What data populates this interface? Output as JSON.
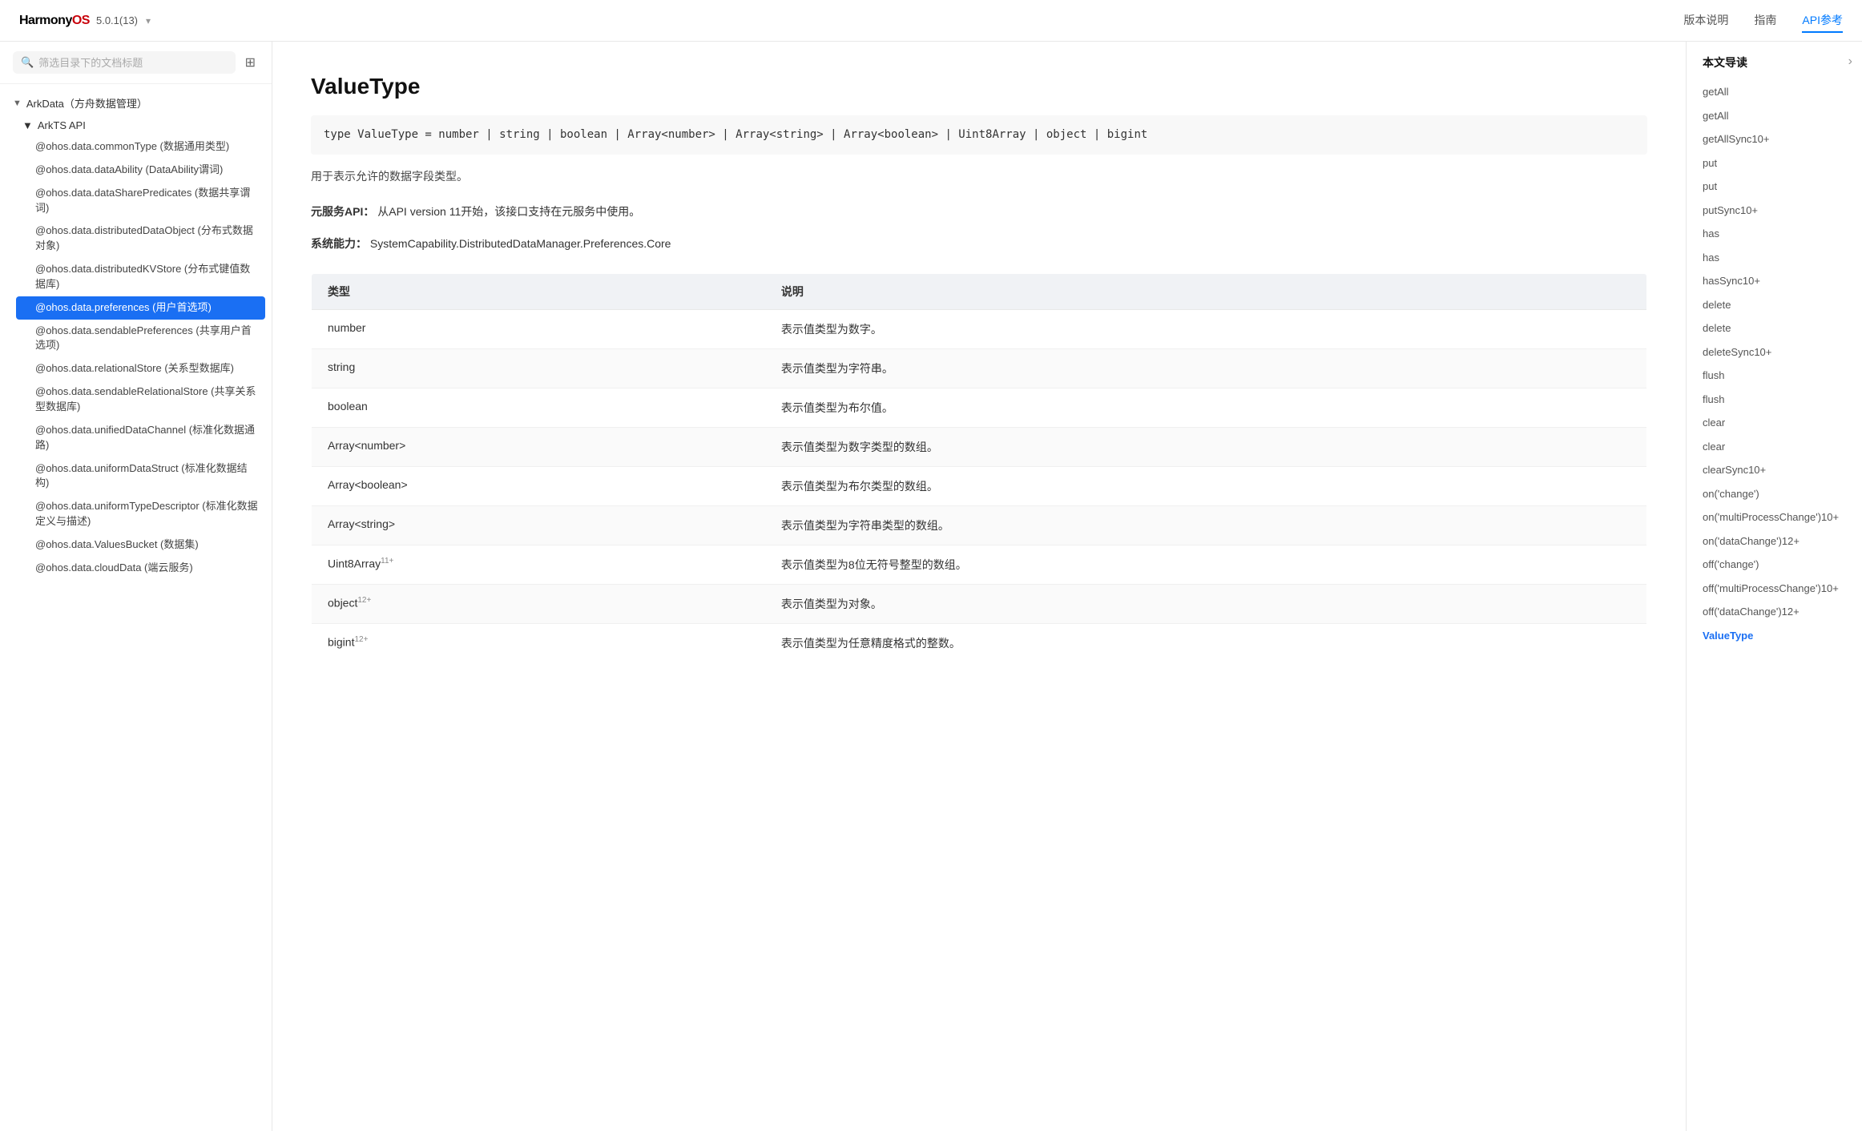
{
  "brand": {
    "name_part1": "Harmony",
    "name_part2": "OS",
    "version": "5.0.1(13)",
    "dropdown_icon": "▾"
  },
  "nav": {
    "links": [
      {
        "label": "版本说明",
        "active": false
      },
      {
        "label": "指南",
        "active": false
      },
      {
        "label": "API参考",
        "active": true
      }
    ]
  },
  "sidebar": {
    "search_placeholder": "筛选目录下的文档标题",
    "tree": {
      "section_label": "ArkData（方舟数据管理）",
      "sub_section_label": "ArkTS API",
      "items": [
        {
          "label": "@ohos.data.commonType (数据通用类型)",
          "active": false
        },
        {
          "label": "@ohos.data.dataAbility (DataAbility谓词)",
          "active": false
        },
        {
          "label": "@ohos.data.dataSharePredicates (数据共享谓词)",
          "active": false
        },
        {
          "label": "@ohos.data.distributedDataObject (分布式数据对象)",
          "active": false
        },
        {
          "label": "@ohos.data.distributedKVStore (分布式键值数据库)",
          "active": false
        },
        {
          "label": "@ohos.data.preferences (用户首选项)",
          "active": true
        },
        {
          "label": "@ohos.data.sendablePreferences (共享用户首选项)",
          "active": false
        },
        {
          "label": "@ohos.data.relationalStore (关系型数据库)",
          "active": false
        },
        {
          "label": "@ohos.data.sendableRelationalStore (共享关系型数据库)",
          "active": false
        },
        {
          "label": "@ohos.data.unifiedDataChannel (标准化数据通路)",
          "active": false
        },
        {
          "label": "@ohos.data.uniformDataStruct (标准化数据结构)",
          "active": false
        },
        {
          "label": "@ohos.data.uniformTypeDescriptor (标准化数据定义与描述)",
          "active": false
        },
        {
          "label": "@ohos.data.ValuesBucket (数据集)",
          "active": false
        },
        {
          "label": "@ohos.data.cloudData (端云服务)",
          "active": false
        }
      ]
    }
  },
  "content": {
    "title": "ValueType",
    "type_signature": "type ValueType = number | string | boolean | Array<number> | Array<string> | Array<boolean> | Uint8Array | object | bigint",
    "description": "用于表示允许的数据字段类型。",
    "meta": {
      "label": "元服务API：",
      "text": "从API version 11开始，该接口支持在元服务中使用。"
    },
    "system_cap": {
      "label": "系统能力：",
      "text": "SystemCapability.DistributedDataManager.Preferences.Core"
    },
    "table": {
      "columns": [
        "类型",
        "说明"
      ],
      "rows": [
        {
          "type": "number",
          "type_sup": "",
          "desc": "表示值类型为数字。"
        },
        {
          "type": "string",
          "type_sup": "",
          "desc": "表示值类型为字符串。"
        },
        {
          "type": "boolean",
          "type_sup": "",
          "desc": "表示值类型为布尔值。"
        },
        {
          "type": "Array<number>",
          "type_sup": "",
          "desc": "表示值类型为数字类型的数组。"
        },
        {
          "type": "Array<boolean>",
          "type_sup": "",
          "desc": "表示值类型为布尔类型的数组。"
        },
        {
          "type": "Array<string>",
          "type_sup": "",
          "desc": "表示值类型为字符串类型的数组。"
        },
        {
          "type": "Uint8Array",
          "type_sup": "11+",
          "desc": "表示值类型为8位无符号整型的数组。"
        },
        {
          "type": "object",
          "type_sup": "12+",
          "desc": "表示值类型为对象。"
        },
        {
          "type": "bigint",
          "type_sup": "12+",
          "desc": "表示值类型为任意精度格式的整数。"
        }
      ]
    }
  },
  "toc": {
    "header": "本文导读",
    "items": [
      {
        "label": "getAll",
        "active": false
      },
      {
        "label": "getAll",
        "active": false
      },
      {
        "label": "getAllSync10+",
        "active": false
      },
      {
        "label": "put",
        "active": false
      },
      {
        "label": "put",
        "active": false
      },
      {
        "label": "putSync10+",
        "active": false
      },
      {
        "label": "has",
        "active": false
      },
      {
        "label": "has",
        "active": false
      },
      {
        "label": "hasSync10+",
        "active": false
      },
      {
        "label": "delete",
        "active": false
      },
      {
        "label": "delete",
        "active": false
      },
      {
        "label": "deleteSync10+",
        "active": false
      },
      {
        "label": "flush",
        "active": false
      },
      {
        "label": "flush",
        "active": false
      },
      {
        "label": "clear",
        "active": false
      },
      {
        "label": "clear",
        "active": false
      },
      {
        "label": "clearSync10+",
        "active": false
      },
      {
        "label": "on('change')",
        "active": false
      },
      {
        "label": "on('multiProcessChange')10+",
        "active": false
      },
      {
        "label": "on('dataChange')12+",
        "active": false
      },
      {
        "label": "off('change')",
        "active": false
      },
      {
        "label": "off('multiProcessChange')10+",
        "active": false
      },
      {
        "label": "off('dataChange')12+",
        "active": false
      },
      {
        "label": "ValueType",
        "active": true
      }
    ],
    "collapse_icon": "›"
  }
}
